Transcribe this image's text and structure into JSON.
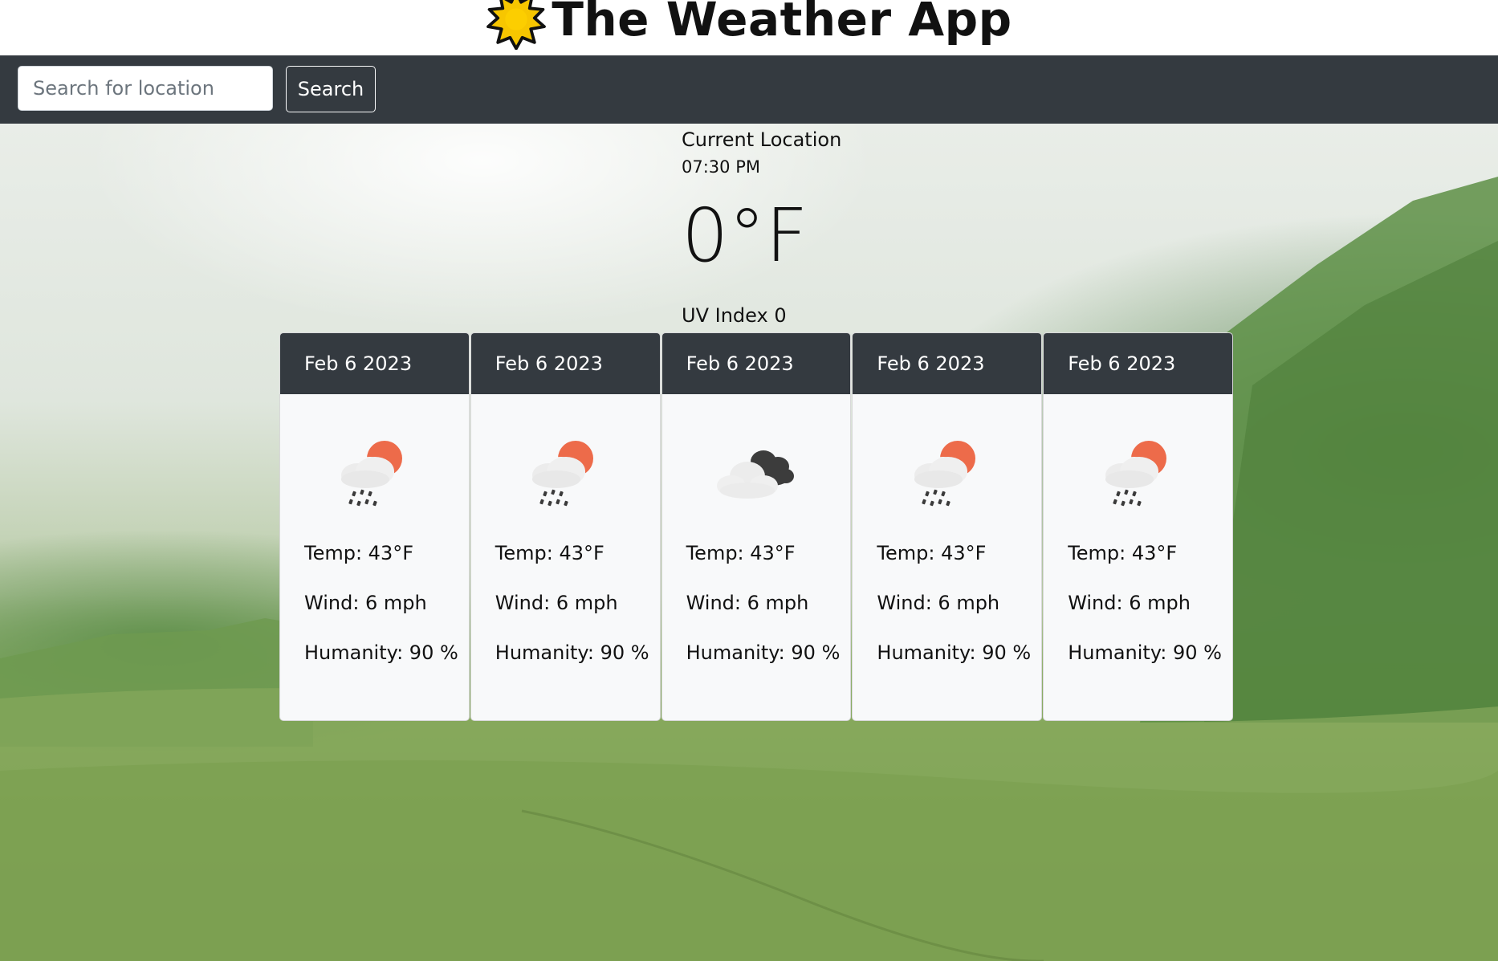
{
  "app": {
    "title": "The Weather App",
    "logo_icon": "sun-icon"
  },
  "search": {
    "placeholder": "Search for location",
    "value": "",
    "button_label": "Search"
  },
  "current": {
    "location": "Current Location",
    "time": "07:30 PM",
    "temperature": "0°F",
    "uv_index": "UV Index 0"
  },
  "forecast": [
    {
      "date": "Feb 6 2023",
      "icon": "rain-night-icon",
      "temp": "Temp: 43°F",
      "wind": "Wind: 6 mph",
      "humidity": "Humanity: 90 %"
    },
    {
      "date": "Feb 6 2023",
      "icon": "rain-night-icon",
      "temp": "Temp: 43°F",
      "wind": "Wind: 6 mph",
      "humidity": "Humanity: 90 %"
    },
    {
      "date": "Feb 6 2023",
      "icon": "cloudy-icon",
      "temp": "Temp: 43°F",
      "wind": "Wind: 6 mph",
      "humidity": "Humanity: 90 %"
    },
    {
      "date": "Feb 6 2023",
      "icon": "rain-night-icon",
      "temp": "Temp: 43°F",
      "wind": "Wind: 6 mph",
      "humidity": "Humanity: 90 %"
    },
    {
      "date": "Feb 6 2023",
      "icon": "rain-night-icon",
      "temp": "Temp: 43°F",
      "wind": "Wind: 6 mph",
      "humidity": "Humanity: 90 %"
    }
  ],
  "colors": {
    "navbar": "#343a40",
    "card_background": "#f8f9fa",
    "sun_accent": "#ed6b4a"
  }
}
